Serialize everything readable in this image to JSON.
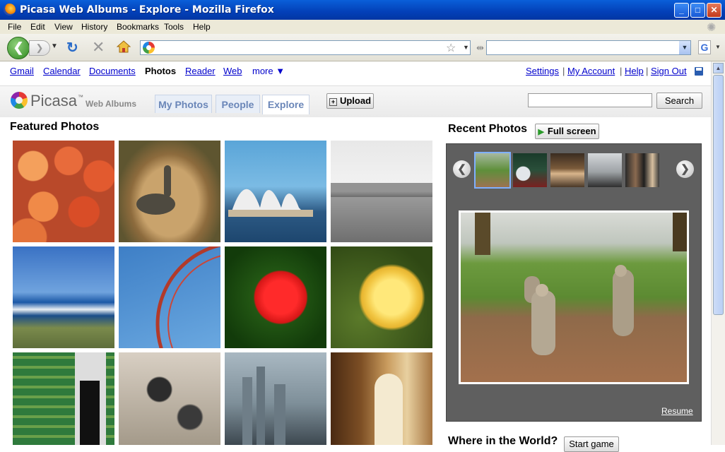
{
  "window": {
    "title": "Picasa Web Albums - Explore - Mozilla Firefox"
  },
  "menu": [
    "File",
    "Edit",
    "View",
    "History",
    "Bookmarks",
    "Tools",
    "Help"
  ],
  "google_bar": {
    "links": [
      "Gmail",
      "Calendar",
      "Documents",
      "Photos",
      "Reader",
      "Web",
      "more ▼"
    ],
    "current": "Photos",
    "right_links": [
      "Settings",
      "My Account",
      "Help",
      "Sign Out"
    ],
    "separator": "|"
  },
  "picasa": {
    "logo": "Picasa",
    "tm": "™",
    "subtitle": "Web Albums",
    "tabs": [
      "My Photos",
      "People",
      "Explore"
    ],
    "active_tab": "Explore",
    "upload_label": "Upload",
    "search_button": "Search",
    "search_placeholder": ""
  },
  "featured": {
    "heading": "Featured Photos"
  },
  "recent": {
    "heading": "Recent Photos",
    "fullscreen_label": "Full screen",
    "resume_label": "Resume"
  },
  "world": {
    "heading": "Where in the World?",
    "button": "Start game"
  },
  "icons": [
    "firefox-icon",
    "back-icon",
    "forward-icon",
    "reload-icon",
    "stop-icon",
    "home-icon",
    "bookmark-star-icon",
    "google-search-icon",
    "save-icon",
    "prev-arrow-icon",
    "next-arrow-icon",
    "play-icon",
    "upload-icon"
  ]
}
